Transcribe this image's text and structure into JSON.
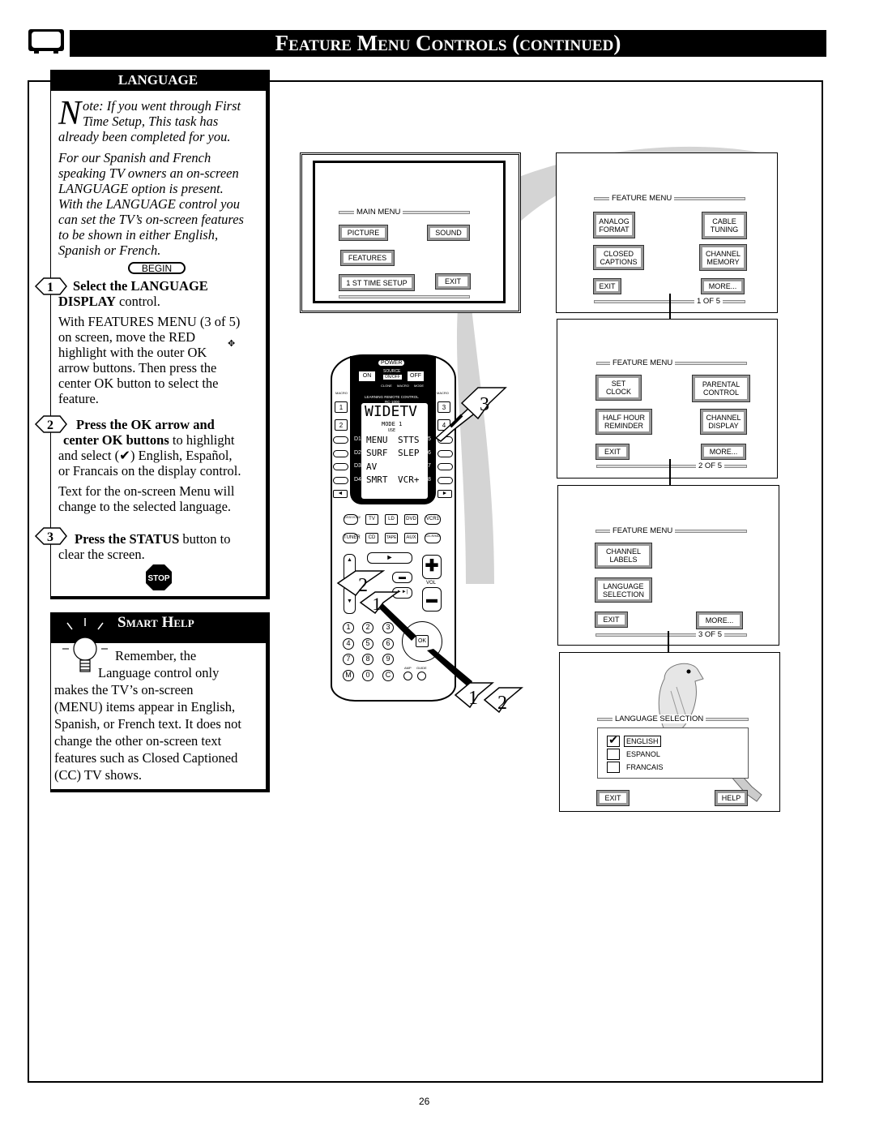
{
  "header": {
    "title": "Feature Menu Controls (continued)",
    "tv_icon": "tv-icon"
  },
  "language_panel": {
    "heading": "LANGUAGE",
    "note_initial": "N",
    "note_lines": [
      "ote: If you went through First",
      "Time Setup, This task has",
      "already been completed for you."
    ],
    "intro_lines": [
      "For our Spanish and French",
      "speaking TV owners an on-screen",
      "LANGUAGE option is present.",
      "With the LANGUAGE control you",
      "can set the TV’s on-screen features",
      "to be shown in either English,",
      "Spanish or French."
    ],
    "begin": "BEGIN",
    "step1": {
      "num": "1",
      "bold1": "Select the LANGUAGE",
      "bold2": "DISPLAY",
      "rest": " control.",
      "body": [
        "With FEATURES MENU (3 of 5)",
        "on screen, move the RED",
        "highlight with the outer OK",
        "arrow buttons. Then press the",
        "center OK button to select the",
        "feature."
      ]
    },
    "step2": {
      "num": "2",
      "bold1": "Press the OK arrow and",
      "bold2": "center OK buttons",
      "rest": " to highlight",
      "body": [
        "and select (✔) English, Español,",
        "or Francais on the display control."
      ],
      "note": [
        "Text for the on-screen Menu will",
        "change to the selected language."
      ]
    },
    "step3": {
      "num": "3",
      "bold": "Press the STATUS",
      "rest": " button to",
      "line2": "clear the screen."
    },
    "stop": "STOP"
  },
  "smart_help": {
    "heading": "Smart Help",
    "lines": [
      "Remember, the",
      "Language control only",
      "makes the TV’s on-screen",
      "(MENU) items appear in English,",
      "Spanish, or French text. It does not",
      "change the other on-screen text",
      "features such as Closed Captioned",
      "(CC) TV shows."
    ]
  },
  "main_menu": {
    "title": "MAIN MENU",
    "picture": "PICTURE",
    "sound": "SOUND",
    "features": "FEATURES",
    "first_time": "1 ST TIME SETUP",
    "exit": "EXIT"
  },
  "feature_menus": [
    {
      "title": "FEATURE MENU",
      "b1": "ANALOG FORMAT",
      "b2": "CABLE TUNING",
      "b3": "CLOSED CAPTIONS",
      "b4": "CHANNEL MEMORY",
      "exit": "EXIT",
      "more": "MORE...",
      "page": "1 OF 5"
    },
    {
      "title": "FEATURE MENU",
      "b1": "SET CLOCK",
      "b2": "PARENTAL CONTROL",
      "b3": "HALF HOUR REMINDER",
      "b4": "CHANNEL DISPLAY",
      "exit": "EXIT",
      "more": "MORE...",
      "page": "2 OF 5"
    },
    {
      "title": "FEATURE MENU",
      "b1": "CHANNEL LABELS",
      "b3": "LANGUAGE SELECTION",
      "exit": "EXIT",
      "more": "MORE...",
      "page": "3 OF 5"
    }
  ],
  "language_selection": {
    "title": "LANGUAGE SELECTION",
    "options": [
      {
        "label": "ENGLISH",
        "checked": true
      },
      {
        "label": "ESPANOL",
        "checked": false
      },
      {
        "label": "FRANCAIS",
        "checked": false
      }
    ],
    "exit": "EXIT",
    "help": "HELP"
  },
  "remote": {
    "power": "POWER",
    "on": "ON",
    "off": "OFF",
    "source": "SOURCE",
    "onoff": "ON/OFF",
    "clone": "CLONE",
    "macro": "MACRO",
    "mode": "MODE",
    "macro_left": "MACRO",
    "macro_right": "MACRO",
    "learning": "LEARNING REMOTE CONTROL",
    "model": "RC-1000",
    "display": "WIDETV",
    "mode_line": "MODE 1",
    "use": "USE",
    "lcd_left": [
      "MENU",
      "SURF",
      "AV",
      "SMRT"
    ],
    "lcd_right": [
      "STTS",
      "SLEP",
      "",
      "VCR+"
    ],
    "d_left": [
      "D1",
      "D2",
      "D3",
      "D4"
    ],
    "d_right": [
      "D5",
      "D6",
      "D7",
      "D8"
    ],
    "macro_keys": [
      "1",
      "2",
      "3",
      "4"
    ],
    "sources_row1": [
      "DSS/VCR2",
      "TV",
      "LD",
      "DVD",
      "VCR1"
    ],
    "sources_row2": [
      "TUNER",
      "CD",
      "TAPE",
      "AUX",
      "CD-R/MD"
    ],
    "vol": "VOL",
    "ok": "OK",
    "amp": "AMP",
    "guide": "GUIDE",
    "keypad": [
      "1",
      "2",
      "3",
      "4",
      "5",
      "6",
      "7",
      "8",
      "9",
      "M",
      "0",
      "C"
    ],
    "callouts": [
      "3",
      "2",
      "1",
      "1",
      "2"
    ]
  },
  "page_number": "26"
}
